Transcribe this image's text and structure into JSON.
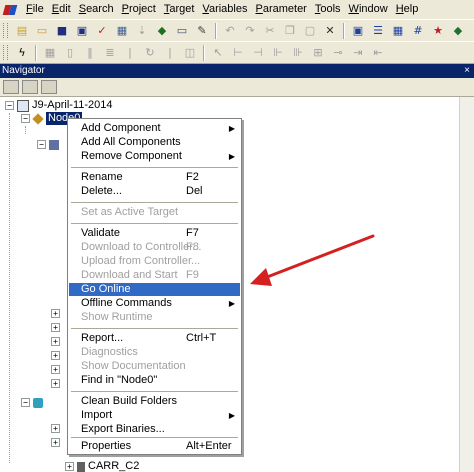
{
  "menubar": {
    "items": [
      {
        "label": "File",
        "u": "F",
        "rest": "ile"
      },
      {
        "label": "Edit",
        "u": "E",
        "rest": "dit"
      },
      {
        "label": "Search",
        "u": "S",
        "rest": "earch"
      },
      {
        "label": "Project",
        "u": "P",
        "rest": "roject"
      },
      {
        "label": "Target",
        "u": "T",
        "rest": "arget"
      },
      {
        "label": "Variables",
        "u": "V",
        "rest": "ariables"
      },
      {
        "label": "Parameter",
        "u": "P",
        "rest": "arameter"
      },
      {
        "label": "Tools",
        "u": "T",
        "rest": "ools"
      },
      {
        "label": "Window",
        "u": "W",
        "rest": "indow"
      },
      {
        "label": "Help",
        "u": "H",
        "rest": "elp"
      }
    ]
  },
  "navigator": {
    "title": "Navigator",
    "close": "×"
  },
  "tree": {
    "root_label": "J9-April-11-2014",
    "node_label": "Node0",
    "carr_label": "CARR_C2",
    "expand_minus": "−",
    "expand_plus": "+"
  },
  "context_menu": {
    "items": [
      {
        "label": "Add Component",
        "shortcut": "",
        "submenu": true,
        "disabled": false
      },
      {
        "label": "Add All Components",
        "shortcut": "",
        "submenu": false,
        "disabled": false
      },
      {
        "label": "Remove Component",
        "shortcut": "",
        "submenu": true,
        "disabled": false
      },
      {
        "label": "Rename",
        "shortcut": "F2",
        "submenu": false,
        "disabled": false
      },
      {
        "label": "Delete...",
        "shortcut": "Del",
        "submenu": false,
        "disabled": false
      },
      {
        "label": "Set as Active Target",
        "shortcut": "",
        "submenu": false,
        "disabled": true
      },
      {
        "label": "Validate",
        "shortcut": "F7",
        "submenu": false,
        "disabled": false
      },
      {
        "label": "Download to Controller...",
        "shortcut": "F8",
        "submenu": false,
        "disabled": true
      },
      {
        "label": "Upload from Controller...",
        "shortcut": "",
        "submenu": false,
        "disabled": true
      },
      {
        "label": "Download and Start",
        "shortcut": "F9",
        "submenu": false,
        "disabled": true
      },
      {
        "label": "Go Online",
        "shortcut": "",
        "submenu": false,
        "disabled": false,
        "highlighted": true
      },
      {
        "label": "Offline Commands",
        "shortcut": "",
        "submenu": true,
        "disabled": false
      },
      {
        "label": "Show Runtime",
        "shortcut": "",
        "submenu": false,
        "disabled": true
      },
      {
        "label": "Report...",
        "shortcut": "Ctrl+T",
        "submenu": false,
        "disabled": false
      },
      {
        "label": "Diagnostics",
        "shortcut": "",
        "submenu": false,
        "disabled": true
      },
      {
        "label": "Show Documentation",
        "shortcut": "",
        "submenu": false,
        "disabled": true
      },
      {
        "label": "Find in \"Node0\"",
        "shortcut": "",
        "submenu": false,
        "disabled": false
      },
      {
        "label": "Clean Build Folders",
        "shortcut": "",
        "submenu": false,
        "disabled": false
      },
      {
        "label": "Import",
        "shortcut": "",
        "submenu": true,
        "disabled": false
      },
      {
        "label": "Export Binaries...",
        "shortcut": "",
        "submenu": false,
        "disabled": false
      },
      {
        "label": "Properties",
        "shortcut": "Alt+Enter",
        "submenu": false,
        "disabled": false
      }
    ],
    "submenu_glyph": "▶"
  },
  "colors": {
    "highlight": "#316ac5",
    "title_bar": "#0a246a",
    "arrow": "#d42020"
  }
}
